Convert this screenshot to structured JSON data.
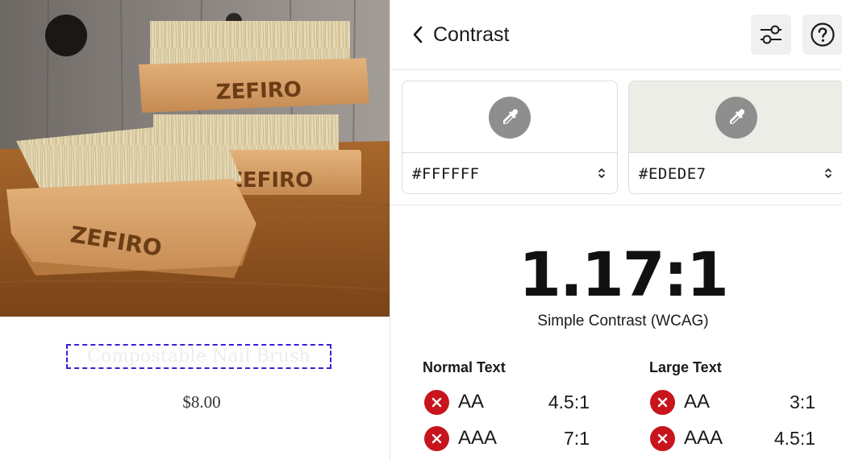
{
  "product": {
    "title": "Compostable Nail Brush",
    "price": "$8.00",
    "photo_brand_text": "ZEFIRO"
  },
  "panel": {
    "title": "Contrast",
    "icons": {
      "back": "chevron-left-icon",
      "settings": "sliders-icon",
      "help": "question-circle-icon"
    }
  },
  "colors": {
    "foreground": {
      "hex": "#FFFFFF",
      "swatch": "#ffffff",
      "icon": "eyedropper-icon"
    },
    "background": {
      "hex": "#EDEDE7",
      "swatch": "#ededE7",
      "icon": "eyedropper-icon"
    },
    "fail": "#c8141c"
  },
  "result": {
    "ratio": "1.17:1",
    "label": "Simple Contrast (WCAG)"
  },
  "normal_text": {
    "heading": "Normal Text",
    "rows": [
      {
        "level": "AA",
        "required": "4.5:1",
        "status": "fail"
      },
      {
        "level": "AAA",
        "required": "7:1",
        "status": "fail"
      }
    ]
  },
  "large_text": {
    "heading": "Large Text",
    "rows": [
      {
        "level": "AA",
        "required": "3:1",
        "status": "fail"
      },
      {
        "level": "AAA",
        "required": "4.5:1",
        "status": "fail"
      }
    ]
  }
}
